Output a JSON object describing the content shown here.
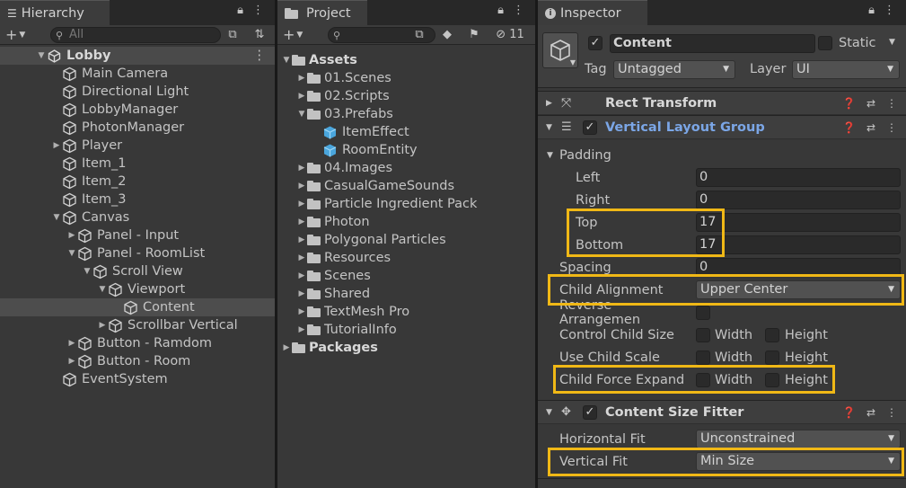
{
  "hierarchy": {
    "tab": "Hierarchy",
    "search_placeholder": "All",
    "items": [
      {
        "label": "Lobby",
        "depth": 0,
        "arrow": "open",
        "icon": "unity-scene-icon",
        "bold": true
      },
      {
        "label": "Main Camera",
        "depth": 1,
        "arrow": "none",
        "icon": "gameobject-icon"
      },
      {
        "label": "Directional Light",
        "depth": 1,
        "arrow": "none",
        "icon": "gameobject-icon"
      },
      {
        "label": "LobbyManager",
        "depth": 1,
        "arrow": "none",
        "icon": "gameobject-icon"
      },
      {
        "label": "PhotonManager",
        "depth": 1,
        "arrow": "none",
        "icon": "gameobject-icon"
      },
      {
        "label": "Player",
        "depth": 1,
        "arrow": "closed",
        "icon": "gameobject-icon"
      },
      {
        "label": "Item_1",
        "depth": 1,
        "arrow": "none",
        "icon": "gameobject-icon"
      },
      {
        "label": "Item_2",
        "depth": 1,
        "arrow": "none",
        "icon": "gameobject-icon"
      },
      {
        "label": "Item_3",
        "depth": 1,
        "arrow": "none",
        "icon": "gameobject-icon"
      },
      {
        "label": "Canvas",
        "depth": 1,
        "arrow": "open",
        "icon": "gameobject-icon"
      },
      {
        "label": "Panel - Input",
        "depth": 2,
        "arrow": "closed",
        "icon": "gameobject-icon"
      },
      {
        "label": "Panel - RoomList",
        "depth": 2,
        "arrow": "open",
        "icon": "gameobject-icon"
      },
      {
        "label": "Scroll View",
        "depth": 3,
        "arrow": "open",
        "icon": "gameobject-icon"
      },
      {
        "label": "Viewport",
        "depth": 4,
        "arrow": "open",
        "icon": "gameobject-icon"
      },
      {
        "label": "Content",
        "depth": 5,
        "arrow": "none",
        "icon": "gameobject-icon",
        "selected": true
      },
      {
        "label": "Scrollbar Vertical",
        "depth": 4,
        "arrow": "closed",
        "icon": "gameobject-icon"
      },
      {
        "label": "Button - Ramdom",
        "depth": 2,
        "arrow": "closed",
        "icon": "gameobject-icon"
      },
      {
        "label": "Button - Room",
        "depth": 2,
        "arrow": "closed",
        "icon": "gameobject-icon"
      },
      {
        "label": "EventSystem",
        "depth": 1,
        "arrow": "none",
        "icon": "gameobject-icon"
      }
    ]
  },
  "project": {
    "tab": "Project",
    "hidden_count": "11",
    "items": [
      {
        "label": "Assets",
        "depth": 0,
        "arrow": "open",
        "icon": "folder-icon",
        "bold": true
      },
      {
        "label": "01.Scenes",
        "depth": 1,
        "arrow": "closed",
        "icon": "folder-icon"
      },
      {
        "label": "02.Scripts",
        "depth": 1,
        "arrow": "closed",
        "icon": "folder-icon"
      },
      {
        "label": "03.Prefabs",
        "depth": 1,
        "arrow": "open",
        "icon": "folder-open-icon"
      },
      {
        "label": "ItemEffect",
        "depth": 2,
        "arrow": "none",
        "icon": "prefab-icon"
      },
      {
        "label": "RoomEntity",
        "depth": 2,
        "arrow": "none",
        "icon": "prefab-icon"
      },
      {
        "label": "04.Images",
        "depth": 1,
        "arrow": "closed",
        "icon": "folder-icon"
      },
      {
        "label": "CasualGameSounds",
        "depth": 1,
        "arrow": "closed",
        "icon": "folder-icon"
      },
      {
        "label": "Particle Ingredient Pack",
        "depth": 1,
        "arrow": "closed",
        "icon": "folder-icon"
      },
      {
        "label": "Photon",
        "depth": 1,
        "arrow": "closed",
        "icon": "folder-icon"
      },
      {
        "label": "Polygonal Particles",
        "depth": 1,
        "arrow": "closed",
        "icon": "folder-icon"
      },
      {
        "label": "Resources",
        "depth": 1,
        "arrow": "closed",
        "icon": "folder-icon"
      },
      {
        "label": "Scenes",
        "depth": 1,
        "arrow": "closed",
        "icon": "folder-icon"
      },
      {
        "label": "Shared",
        "depth": 1,
        "arrow": "closed",
        "icon": "folder-icon"
      },
      {
        "label": "TextMesh Pro",
        "depth": 1,
        "arrow": "closed",
        "icon": "folder-icon"
      },
      {
        "label": "TutorialInfo",
        "depth": 1,
        "arrow": "closed",
        "icon": "folder-icon"
      },
      {
        "label": "Packages",
        "depth": 0,
        "arrow": "closed",
        "icon": "folder-icon",
        "bold": true
      }
    ]
  },
  "inspector": {
    "tab": "Inspector",
    "object_name": "Content",
    "static_label": "Static",
    "tag_label": "Tag",
    "tag_value": "Untagged",
    "layer_label": "Layer",
    "layer_value": "UI",
    "rect_transform": "Rect Transform",
    "vlg": {
      "title": "Vertical Layout Group",
      "padding": "Padding",
      "left_label": "Left",
      "left": "0",
      "right_label": "Right",
      "right": "0",
      "top_label": "Top",
      "top": "17",
      "bottom_label": "Bottom",
      "bottom": "17",
      "spacing_label": "Spacing",
      "spacing": "0",
      "child_alignment_label": "Child Alignment",
      "child_alignment": "Upper Center",
      "reverse_label": "Reverse Arrangemen",
      "control_label": "Control Child Size",
      "scale_label": "Use Child Scale",
      "expand_label": "Child Force Expand",
      "width": "Width",
      "height": "Height"
    },
    "csf": {
      "title": "Content Size Fitter",
      "hfit_label": "Horizontal Fit",
      "hfit": "Unconstrained",
      "vfit_label": "Vertical Fit",
      "vfit": "Min Size"
    }
  },
  "colors": {
    "highlight": "#f0b816",
    "selected_row": "#4d4d4d",
    "blue_title": "#7ba6e6"
  }
}
